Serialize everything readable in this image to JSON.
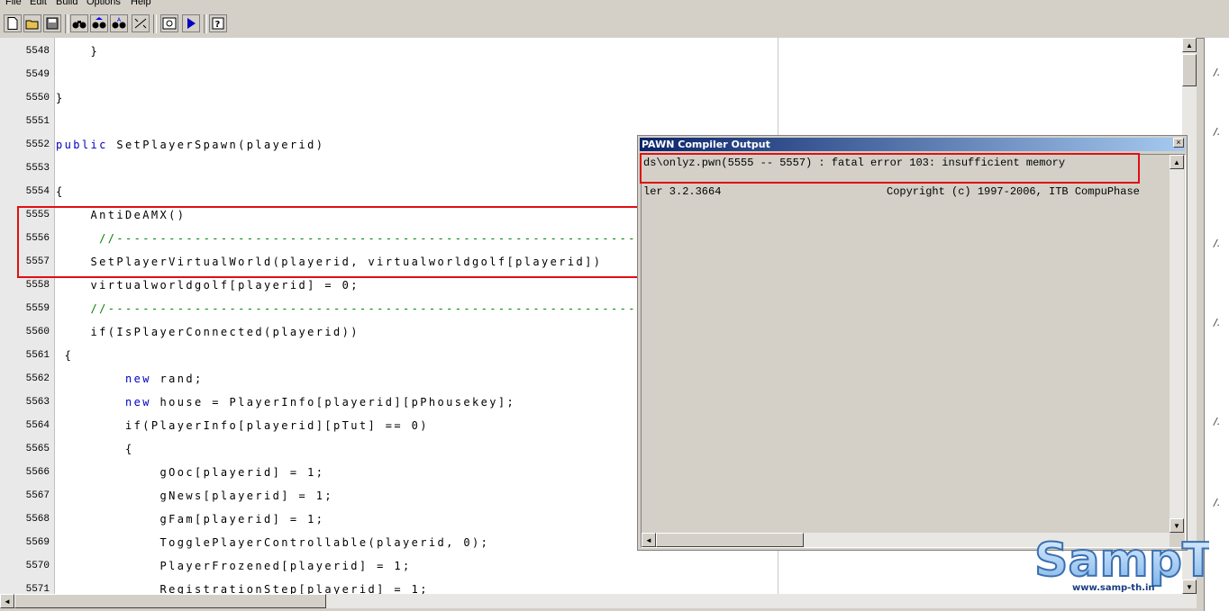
{
  "menu": [
    "File",
    "Edit",
    "Build",
    "Options",
    "Help"
  ],
  "toolbar": {
    "icons": [
      "new-file-icon",
      "open-folder-icon",
      "save-icon",
      "find-icon",
      "find-next-icon",
      "replace-icon",
      "goto-line-icon",
      "compile-icon",
      "run-icon",
      "help-icon"
    ]
  },
  "editor": {
    "lines": [
      {
        "n": "5548",
        "text": "    }"
      },
      {
        "n": "5549",
        "text": ""
      },
      {
        "n": "5550",
        "text": "}"
      },
      {
        "n": "5551",
        "text": ""
      },
      {
        "n": "5552",
        "kw": "public",
        "text": " SetPlayerSpawn(playerid)"
      },
      {
        "n": "5553",
        "text": ""
      },
      {
        "n": "5554",
        "text": "{"
      },
      {
        "n": "5555",
        "text": "    AntiDeAMX()"
      },
      {
        "n": "5556",
        "comment": "     //-------------------------------------------------------------"
      },
      {
        "n": "5557",
        "text": "    SetPlayerVirtualWorld(playerid, virtualworldgolf[playerid])"
      },
      {
        "n": "5558",
        "text": "    virtualworldgolf[playerid] = 0;"
      },
      {
        "n": "5559",
        "comment": "    //--------------------------------------------------------------"
      },
      {
        "n": "5560",
        "text": "    if(IsPlayerConnected(playerid))"
      },
      {
        "n": "5561",
        "text": " {"
      },
      {
        "n": "5562",
        "kw": "        new",
        "text": " rand;"
      },
      {
        "n": "5563",
        "kw": "        new",
        "text": " house = PlayerInfo[playerid][pPhousekey];"
      },
      {
        "n": "5564",
        "text": "        if(PlayerInfo[playerid][pTut] == 0)"
      },
      {
        "n": "5565",
        "text": "        {"
      },
      {
        "n": "5566",
        "text": "            gOoc[playerid] = 1;"
      },
      {
        "n": "5567",
        "text": "            gNews[playerid] = 1;"
      },
      {
        "n": "5568",
        "text": "            gFam[playerid] = 1;"
      },
      {
        "n": "5569",
        "text": "            TogglePlayerControllable(playerid, 0);"
      },
      {
        "n": "5570",
        "text": "            PlayerFrozened[playerid] = 1;"
      },
      {
        "n": "5571",
        "text": "            RegistrationStep[playerid] = 1;"
      }
    ]
  },
  "dialog": {
    "title": "PAWN Compiler Output",
    "close": "×",
    "error_line": "ds\\onlyz.pwn(5555 -- 5557) : fatal error 103: insufficient memory",
    "version_line": "ler 3.2.3664",
    "copyright_line": "Copyright (c) 1997-2006, ITB CompuPhase"
  },
  "logo": {
    "name": "SampTh",
    "url": "www.samp-th.in"
  },
  "colors": {
    "keyword": "#0000c0",
    "comment": "#008000",
    "highlight": "#e01010",
    "titlebar": "#0a246a"
  }
}
